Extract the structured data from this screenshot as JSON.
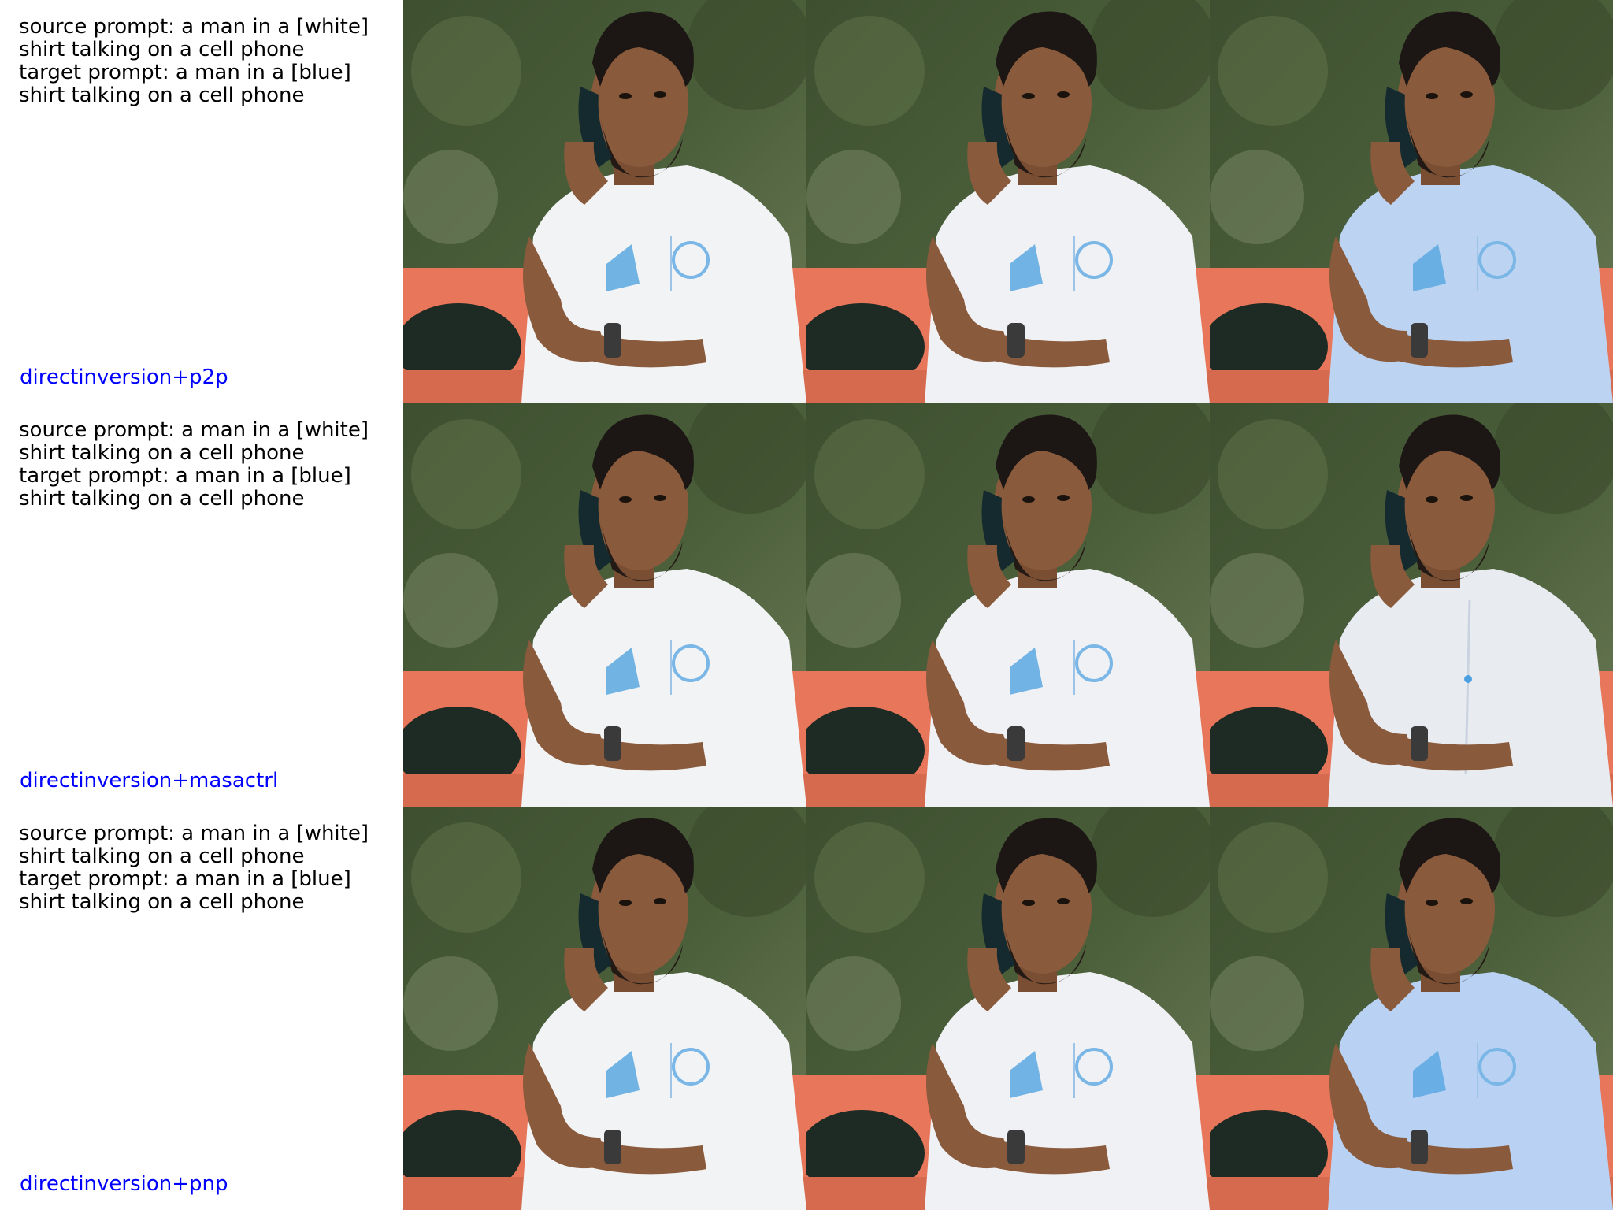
{
  "rows": [
    {
      "source_prompt": "source prompt: a man in a [white] shirt talking on a cell phone",
      "target_prompt": "target prompt: a man in a [blue] shirt talking on a cell phone",
      "method": "directinversion+p2p",
      "cells": [
        {
          "shirt_color": "#f2f3f5",
          "logo": true
        },
        {
          "shirt_color": "#f0f1f4",
          "logo": true
        },
        {
          "shirt_color": "#bcd4f2",
          "logo": true
        }
      ]
    },
    {
      "source_prompt": "source prompt: a man in a [white] shirt talking on a cell phone",
      "target_prompt": "target prompt: a man in a [blue] shirt talking on a cell phone",
      "method": "directinversion+masactrl",
      "cells": [
        {
          "shirt_color": "#f2f3f5",
          "logo": true
        },
        {
          "shirt_color": "#f0f1f4",
          "logo": true
        },
        {
          "shirt_color": "#e8ebf0",
          "logo": false
        }
      ]
    },
    {
      "source_prompt": "source prompt: a man in a [white] shirt talking on a cell phone",
      "target_prompt": "target prompt: a man in a [blue] shirt talking on a cell phone",
      "method": "directinversion+pnp",
      "cells": [
        {
          "shirt_color": "#f2f3f5",
          "logo": true
        },
        {
          "shirt_color": "#f0f1f4",
          "logo": true
        },
        {
          "shirt_color": "#b9d2f3",
          "logo": true
        }
      ]
    }
  ],
  "colors": {
    "label_blue": "#0000ff",
    "foliage": "#4a5e3a",
    "car_orange": "#e8765a",
    "skin": "#8a5a3c",
    "hair": "#1c1714"
  }
}
